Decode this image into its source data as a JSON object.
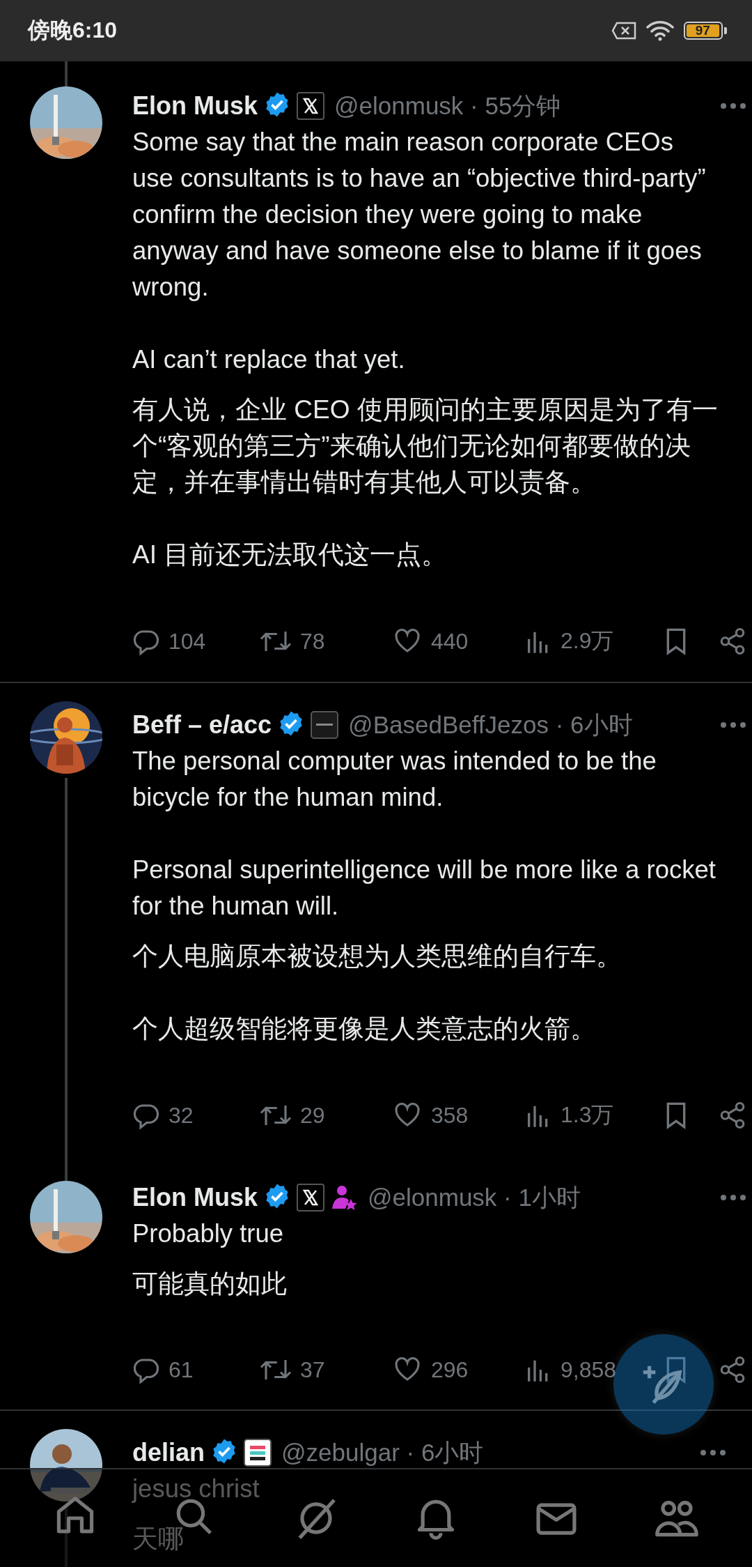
{
  "status_bar": {
    "time": "傍晚6:10",
    "battery": "97"
  },
  "tweets": [
    {
      "name": "Elon Musk",
      "verified": true,
      "badges": [
        {
          "kind": "x-logo"
        }
      ],
      "meta": "@elonmusk · 55分钟",
      "thread_above": true,
      "thread_below": false,
      "text": [
        "Some say that the main reason corporate CEOs use consultants is to have an “objective third-party” confirm the decision they were going to make anyway and have someone else to blame if it goes wrong.",
        "AI can’t replace that yet."
      ],
      "translation": [
        "有人说，企业 CEO 使用顾问的主要原因是为了有一个“客观的第三方”来确认他们无论如何都要做的决定，并在事情出错时有其他人可以责备。",
        "AI 目前还无法取代这一点。"
      ],
      "actions": {
        "replies": "104",
        "reposts": "78",
        "likes": "440",
        "views": "2.9万"
      }
    },
    {
      "name": "Beff – e/acc",
      "verified": true,
      "badges": [
        {
          "kind": "company-logo"
        }
      ],
      "meta": "@BasedBeffJezos · 6小时",
      "thread_above": false,
      "thread_below": true,
      "text": [
        "The personal computer was intended to be the bicycle for the human mind.",
        "Personal superintelligence will be more like a rocket for the human will."
      ],
      "translation": [
        "个人电脑原本被设想为人类思维的自行车。",
        "个人超级智能将更像是人类意志的火箭。"
      ],
      "actions": {
        "replies": "32",
        "reposts": "29",
        "likes": "358",
        "views": "1.3万"
      }
    },
    {
      "name": "Elon Musk",
      "verified": true,
      "badges": [
        {
          "kind": "x-logo"
        },
        {
          "kind": "subscriber"
        }
      ],
      "meta": "@elonmusk · 1小时",
      "thread_above": true,
      "thread_below": false,
      "text": [
        "Probably true"
      ],
      "translation": [
        "可能真的如此"
      ],
      "actions": {
        "replies": "61",
        "reposts": "37",
        "likes": "296",
        "views": "9,858"
      }
    },
    {
      "name": "delian",
      "verified": true,
      "badges": [
        {
          "kind": "flag"
        }
      ],
      "meta": "@zebulgar · 6小时",
      "thread_above": false,
      "thread_below": true,
      "text": [
        "jesus christ"
      ],
      "translation": [
        "天哪"
      ]
    }
  ],
  "nav": [
    {
      "kind": "home"
    },
    {
      "kind": "search"
    },
    {
      "kind": "grok"
    },
    {
      "kind": "notifications"
    },
    {
      "kind": "messages"
    },
    {
      "kind": "communities"
    }
  ]
}
